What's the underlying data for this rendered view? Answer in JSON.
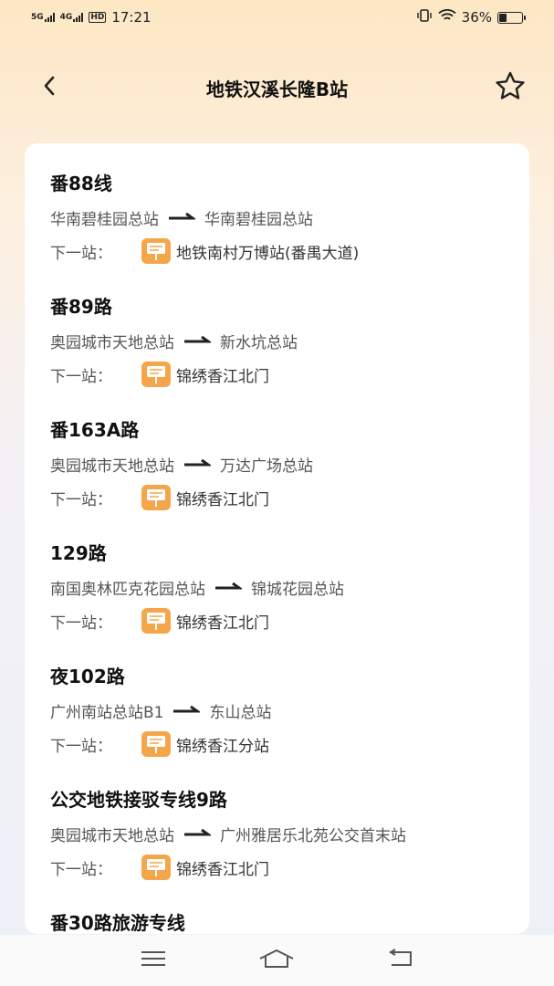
{
  "status_bar": {
    "net1": "5G",
    "net2": "4G",
    "hd": "HD",
    "time": "17:21",
    "battery": "36%",
    "battery_level": 0.36
  },
  "header": {
    "title": "地铁汉溪长隆B站"
  },
  "next_stop_label": "下一站：",
  "routes": [
    {
      "name": "番88线",
      "from": "华南碧桂园总站",
      "to": "华南碧桂园总站",
      "next_stop": "地铁南村万博站(番禺大道)"
    },
    {
      "name": "番89路",
      "from": "奥园城市天地总站",
      "to": "新水坑总站",
      "next_stop": "锦绣香江北门"
    },
    {
      "name": "番163A路",
      "from": "奥园城市天地总站",
      "to": "万达广场总站",
      "next_stop": "锦绣香江北门"
    },
    {
      "name": "129路",
      "from": "南国奥林匹克花园总站",
      "to": "锦城花园总站",
      "next_stop": "锦绣香江北门"
    },
    {
      "name": "夜102路",
      "from": "广州南站总站B1",
      "to": "东山总站",
      "next_stop": "锦绣香江分站"
    },
    {
      "name": "公交地铁接驳专线9路",
      "from": "奥园城市天地总站",
      "to": "广州雅居乐北苑公交首末站",
      "next_stop": "锦绣香江北门"
    },
    {
      "name": "番30路旅游专线"
    }
  ],
  "icons": {
    "back": "chevron-left-icon",
    "favorite": "star-outline-icon",
    "stop": "bus-stop-sign-icon",
    "direction": "arrow-right-icon",
    "menu": "menu-icon",
    "home": "home-icon",
    "back_nav": "back-icon"
  },
  "colors": {
    "stop_icon": "#f5a54a",
    "header_top": "#fde7c4"
  }
}
